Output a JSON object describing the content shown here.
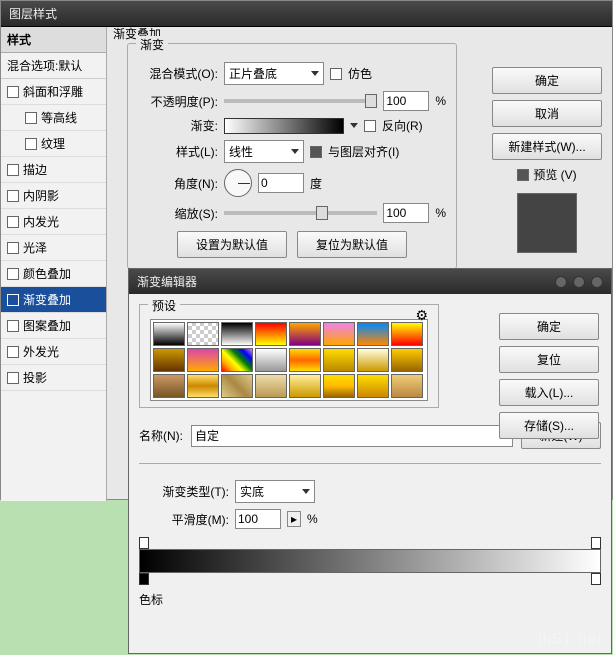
{
  "dialog": {
    "title": "图层样式",
    "section": "渐变叠加",
    "group": "渐变",
    "buttons": {
      "ok": "确定",
      "cancel": "取消",
      "newstyle": "新建样式(W)...",
      "preview": "预览 (V)"
    },
    "defaults": {
      "set": "设置为默认值",
      "reset": "复位为默认值"
    }
  },
  "styles": {
    "head": "样式",
    "blend": "混合选项:默认",
    "items": [
      "斜面和浮雕",
      "等高线",
      "纹理",
      "描边",
      "内阴影",
      "内发光",
      "光泽",
      "颜色叠加",
      "渐变叠加",
      "图案叠加",
      "外发光",
      "投影"
    ]
  },
  "grad": {
    "blendMode": {
      "label": "混合模式(O):",
      "value": "正片叠底",
      "dither": "仿色"
    },
    "opacity": {
      "label": "不透明度(P):",
      "value": "100",
      "unit": "%"
    },
    "gradient": {
      "label": "渐变:",
      "reverse": "反向(R)"
    },
    "style": {
      "label": "样式(L):",
      "value": "线性",
      "align": "与图层对齐(I)"
    },
    "angle": {
      "label": "角度(N):",
      "value": "0",
      "unit": "度"
    },
    "scale": {
      "label": "缩放(S):",
      "value": "100",
      "unit": "%"
    }
  },
  "ge": {
    "title": "渐变编辑器",
    "presets": "预设",
    "ok": "确定",
    "reset": "复位",
    "load": "载入(L)...",
    "save": "存储(S)...",
    "new": "新建(W)",
    "nameLabel": "名称(N):",
    "nameValue": "自定",
    "typeLabel": "渐变类型(T):",
    "typeValue": "实底",
    "smoothLabel": "平滑度(M):",
    "smoothValue": "100",
    "unit": "%",
    "colorStops": "色标",
    "swatches": [
      "linear-gradient(#fff,#000)",
      "repeating-conic-gradient(#ccc 0 25%,#fff 0 50%) 0/8px 8px",
      "linear-gradient(#000,#fff)",
      "linear-gradient(red,yellow)",
      "linear-gradient(orange,purple)",
      "linear-gradient(violet,orange)",
      "linear-gradient(#08f,#f80)",
      "linear-gradient(#ff0,#f00)",
      "linear-gradient(#c90,#630)",
      "linear-gradient(#d4a,#fa0)",
      "linear-gradient(45deg,red,orange,yellow,green,blue,violet)",
      "linear-gradient(#fff,#999)",
      "linear-gradient(#fd0,#f60,#fd0)",
      "linear-gradient(#fd0,#b80)",
      "linear-gradient(#ffd,#c90)",
      "linear-gradient(#fc0,#960)",
      "linear-gradient(#c96,#752)",
      "linear-gradient(#fd6,#c80,#fd6)",
      "linear-gradient(45deg,#dc8,#a84,#dc8)",
      "linear-gradient(#eda,#b95)",
      "linear-gradient(#fe9,#c90)",
      "linear-gradient(#fd0,#fb0,#960)",
      "linear-gradient(#fd0,#c80)",
      "linear-gradient(#ec7,#b84)"
    ]
  },
  "watermark": "jb51.net"
}
